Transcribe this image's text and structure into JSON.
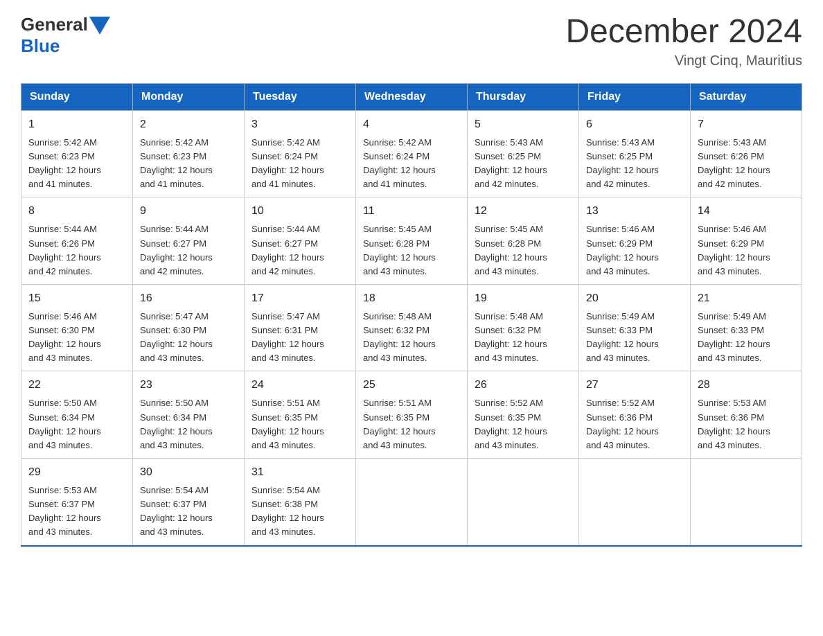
{
  "logo": {
    "text_general": "General",
    "text_blue": "Blue"
  },
  "header": {
    "month_year": "December 2024",
    "location": "Vingt Cinq, Mauritius"
  },
  "weekdays": [
    "Sunday",
    "Monday",
    "Tuesday",
    "Wednesday",
    "Thursday",
    "Friday",
    "Saturday"
  ],
  "weeks": [
    [
      {
        "day": "1",
        "sunrise": "5:42 AM",
        "sunset": "6:23 PM",
        "daylight": "12 hours and 41 minutes."
      },
      {
        "day": "2",
        "sunrise": "5:42 AM",
        "sunset": "6:23 PM",
        "daylight": "12 hours and 41 minutes."
      },
      {
        "day": "3",
        "sunrise": "5:42 AM",
        "sunset": "6:24 PM",
        "daylight": "12 hours and 41 minutes."
      },
      {
        "day": "4",
        "sunrise": "5:42 AM",
        "sunset": "6:24 PM",
        "daylight": "12 hours and 41 minutes."
      },
      {
        "day": "5",
        "sunrise": "5:43 AM",
        "sunset": "6:25 PM",
        "daylight": "12 hours and 42 minutes."
      },
      {
        "day": "6",
        "sunrise": "5:43 AM",
        "sunset": "6:25 PM",
        "daylight": "12 hours and 42 minutes."
      },
      {
        "day": "7",
        "sunrise": "5:43 AM",
        "sunset": "6:26 PM",
        "daylight": "12 hours and 42 minutes."
      }
    ],
    [
      {
        "day": "8",
        "sunrise": "5:44 AM",
        "sunset": "6:26 PM",
        "daylight": "12 hours and 42 minutes."
      },
      {
        "day": "9",
        "sunrise": "5:44 AM",
        "sunset": "6:27 PM",
        "daylight": "12 hours and 42 minutes."
      },
      {
        "day": "10",
        "sunrise": "5:44 AM",
        "sunset": "6:27 PM",
        "daylight": "12 hours and 42 minutes."
      },
      {
        "day": "11",
        "sunrise": "5:45 AM",
        "sunset": "6:28 PM",
        "daylight": "12 hours and 43 minutes."
      },
      {
        "day": "12",
        "sunrise": "5:45 AM",
        "sunset": "6:28 PM",
        "daylight": "12 hours and 43 minutes."
      },
      {
        "day": "13",
        "sunrise": "5:46 AM",
        "sunset": "6:29 PM",
        "daylight": "12 hours and 43 minutes."
      },
      {
        "day": "14",
        "sunrise": "5:46 AM",
        "sunset": "6:29 PM",
        "daylight": "12 hours and 43 minutes."
      }
    ],
    [
      {
        "day": "15",
        "sunrise": "5:46 AM",
        "sunset": "6:30 PM",
        "daylight": "12 hours and 43 minutes."
      },
      {
        "day": "16",
        "sunrise": "5:47 AM",
        "sunset": "6:30 PM",
        "daylight": "12 hours and 43 minutes."
      },
      {
        "day": "17",
        "sunrise": "5:47 AM",
        "sunset": "6:31 PM",
        "daylight": "12 hours and 43 minutes."
      },
      {
        "day": "18",
        "sunrise": "5:48 AM",
        "sunset": "6:32 PM",
        "daylight": "12 hours and 43 minutes."
      },
      {
        "day": "19",
        "sunrise": "5:48 AM",
        "sunset": "6:32 PM",
        "daylight": "12 hours and 43 minutes."
      },
      {
        "day": "20",
        "sunrise": "5:49 AM",
        "sunset": "6:33 PM",
        "daylight": "12 hours and 43 minutes."
      },
      {
        "day": "21",
        "sunrise": "5:49 AM",
        "sunset": "6:33 PM",
        "daylight": "12 hours and 43 minutes."
      }
    ],
    [
      {
        "day": "22",
        "sunrise": "5:50 AM",
        "sunset": "6:34 PM",
        "daylight": "12 hours and 43 minutes."
      },
      {
        "day": "23",
        "sunrise": "5:50 AM",
        "sunset": "6:34 PM",
        "daylight": "12 hours and 43 minutes."
      },
      {
        "day": "24",
        "sunrise": "5:51 AM",
        "sunset": "6:35 PM",
        "daylight": "12 hours and 43 minutes."
      },
      {
        "day": "25",
        "sunrise": "5:51 AM",
        "sunset": "6:35 PM",
        "daylight": "12 hours and 43 minutes."
      },
      {
        "day": "26",
        "sunrise": "5:52 AM",
        "sunset": "6:35 PM",
        "daylight": "12 hours and 43 minutes."
      },
      {
        "day": "27",
        "sunrise": "5:52 AM",
        "sunset": "6:36 PM",
        "daylight": "12 hours and 43 minutes."
      },
      {
        "day": "28",
        "sunrise": "5:53 AM",
        "sunset": "6:36 PM",
        "daylight": "12 hours and 43 minutes."
      }
    ],
    [
      {
        "day": "29",
        "sunrise": "5:53 AM",
        "sunset": "6:37 PM",
        "daylight": "12 hours and 43 minutes."
      },
      {
        "day": "30",
        "sunrise": "5:54 AM",
        "sunset": "6:37 PM",
        "daylight": "12 hours and 43 minutes."
      },
      {
        "day": "31",
        "sunrise": "5:54 AM",
        "sunset": "6:38 PM",
        "daylight": "12 hours and 43 minutes."
      },
      null,
      null,
      null,
      null
    ]
  ],
  "labels": {
    "sunrise": "Sunrise:",
    "sunset": "Sunset:",
    "daylight": "Daylight:"
  }
}
